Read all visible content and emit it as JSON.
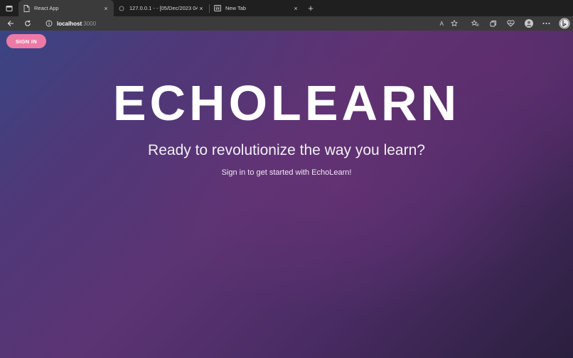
{
  "browser": {
    "tabs": [
      {
        "title": "React App",
        "active": true,
        "icon": "page-icon"
      },
      {
        "title": "127.0.0.1 - - [05/Dec/2023 04:",
        "active": false,
        "icon": "loading-icon"
      },
      {
        "title": "New Tab",
        "active": false,
        "icon": "newtab-icon"
      }
    ],
    "close_glyph": "×",
    "new_tab_glyph": "+",
    "address": {
      "host": "localhost",
      "port": ":3000"
    },
    "read_aloud_glyph": "A"
  },
  "page": {
    "signin_label": "SIGN IN",
    "title": "ECHOLEARN",
    "subtitle": "Ready to revolutionize the way you learn?",
    "tagline": "Sign in to get started with EchoLearn!"
  },
  "colors": {
    "signin_button": "#ed7aa5",
    "chrome_dark": "#1f1f1f",
    "chrome_toolbar": "#3b3b3b"
  }
}
